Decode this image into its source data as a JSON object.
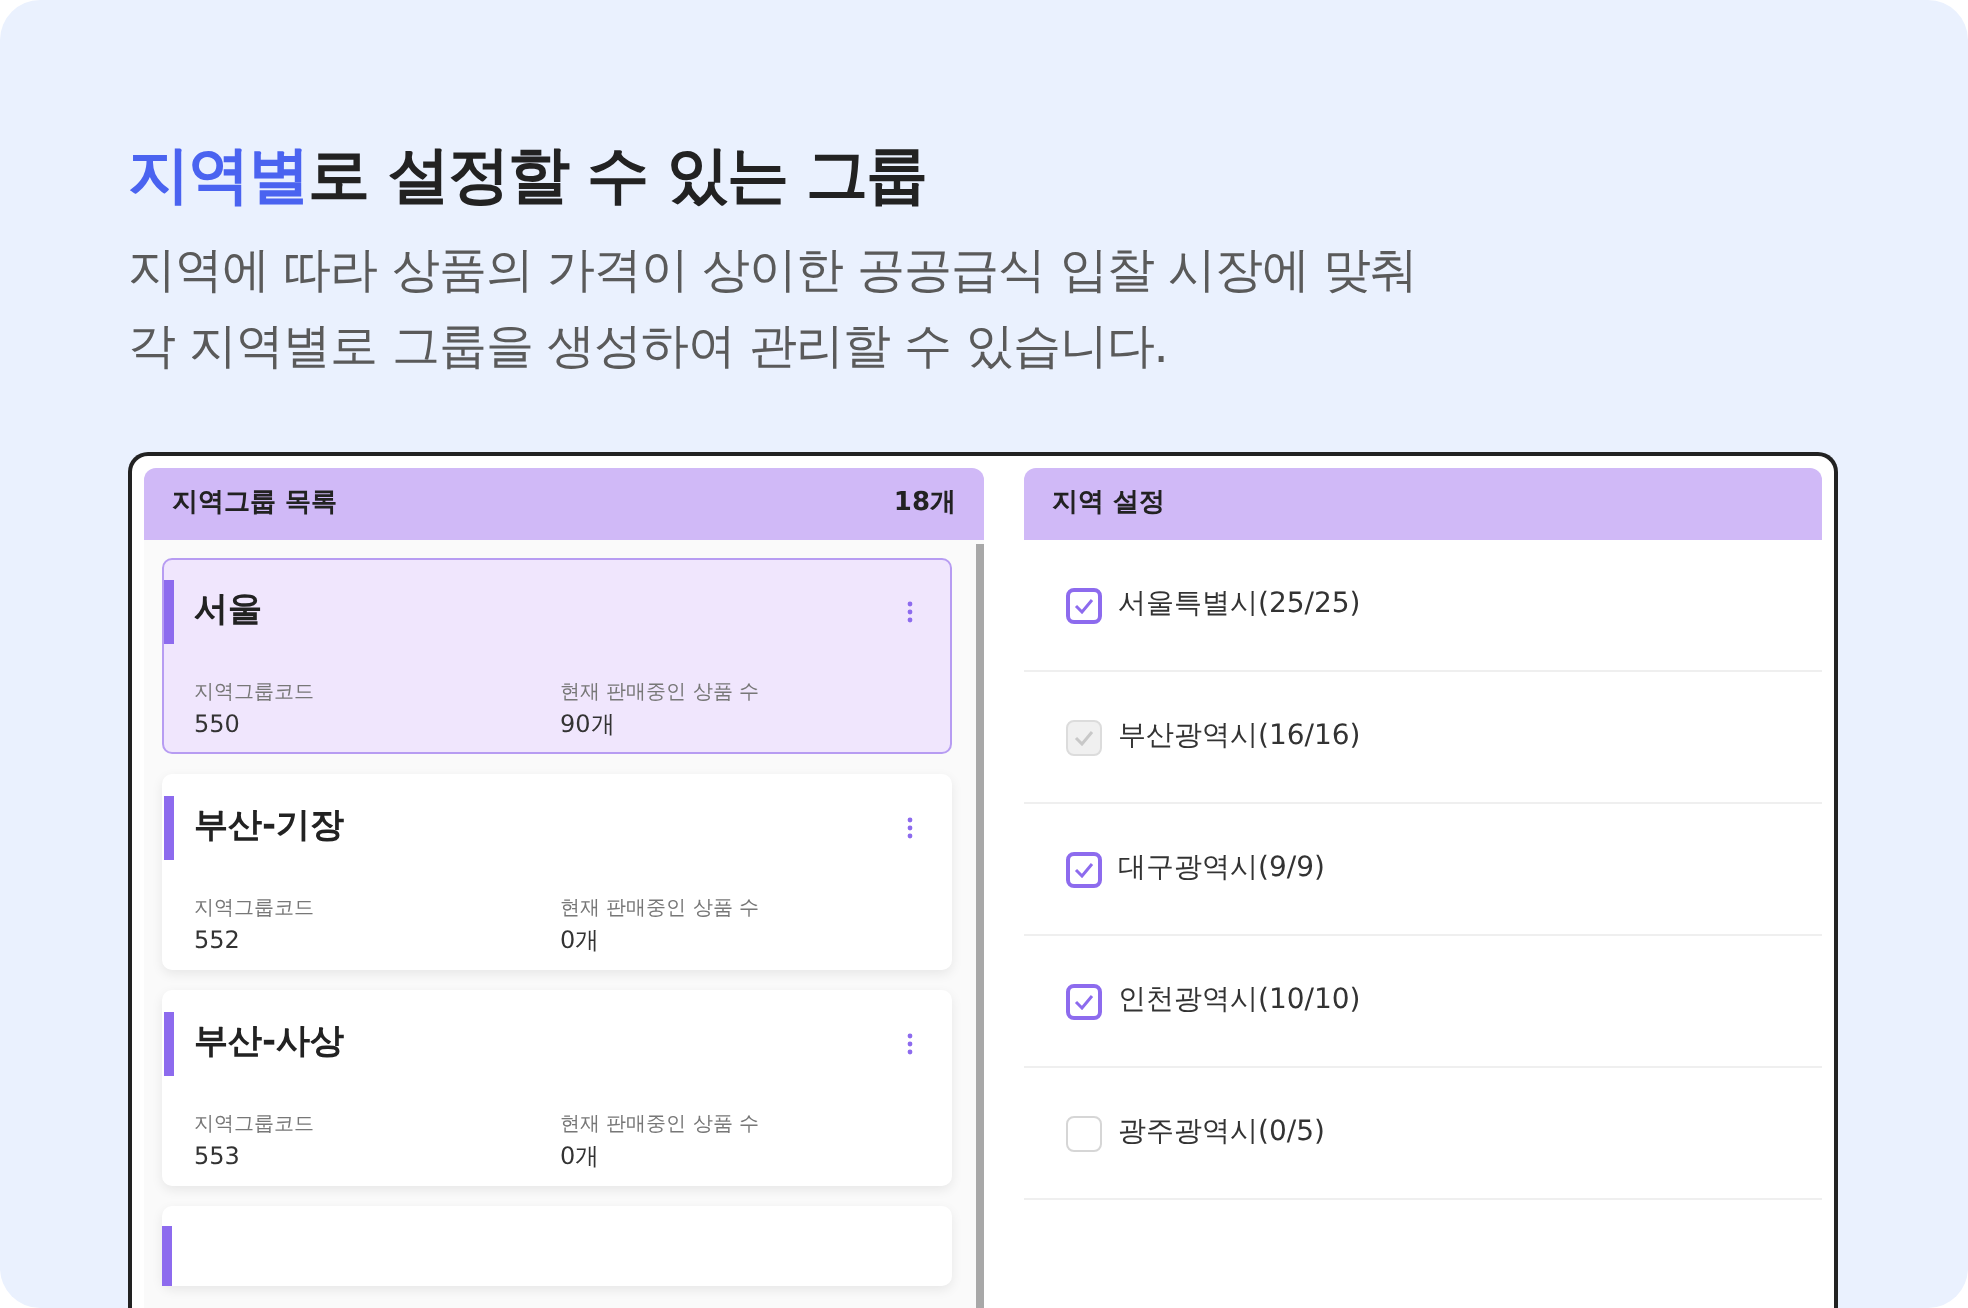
{
  "headline": {
    "highlight": "지역별",
    "rest": "로 설정할 수 있는 그룹"
  },
  "description": [
    "지역에 따라 상품의 가격이 상이한 공공급식 입찰 시장에 맞춰",
    "각 지역별로 그룹을 생성하여 관리할 수 있습니다."
  ],
  "group_list": {
    "title": "지역그룹 목록",
    "count": "18개",
    "groups": [
      {
        "name": "서울",
        "code_label": "지역그룹코드",
        "code": "550",
        "products_label": "현재 판매중인 상품 수",
        "products": "90개",
        "selected": true
      },
      {
        "name": "부산-기장",
        "code_label": "지역그룹코드",
        "code": "552",
        "products_label": "현재 판매중인 상품 수",
        "products": "0개",
        "selected": false
      },
      {
        "name": "부산-사상",
        "code_label": "지역그룹코드",
        "code": "553",
        "products_label": "현재 판매중인 상품 수",
        "products": "0개",
        "selected": false
      }
    ]
  },
  "region_settings": {
    "title": "지역 설정",
    "regions": [
      {
        "label": "서울특별시(25/25)",
        "checked": true,
        "disabled": false
      },
      {
        "label": "부산광역시(16/16)",
        "checked": true,
        "disabled": true
      },
      {
        "label": "대구광역시(9/9)",
        "checked": true,
        "disabled": false
      },
      {
        "label": "인천광역시(10/10)",
        "checked": true,
        "disabled": false
      },
      {
        "label": "광주광역시(0/5)",
        "checked": false,
        "disabled": false
      }
    ]
  }
}
